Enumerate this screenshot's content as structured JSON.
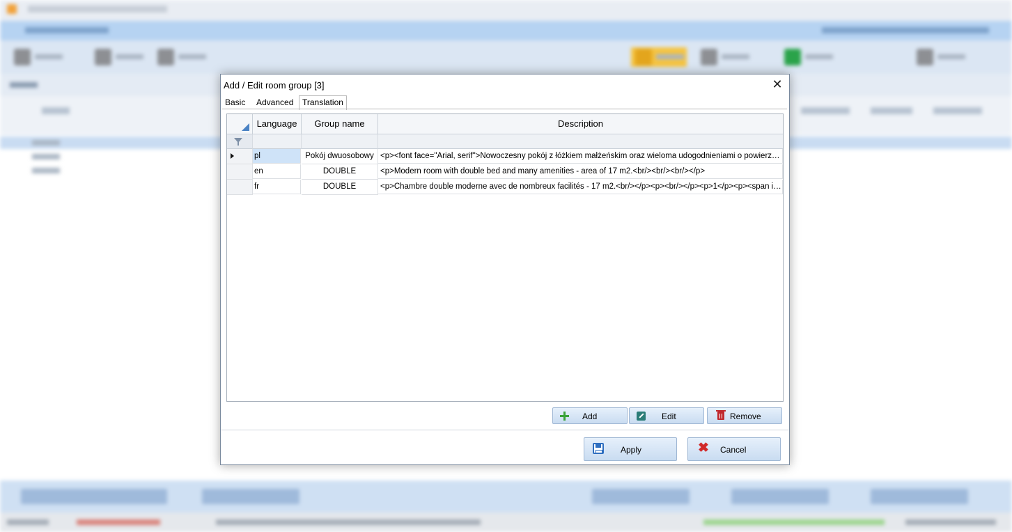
{
  "dialog": {
    "title": "Add / Edit room group [3]",
    "close_glyph": "✕",
    "tabs": [
      {
        "label": "Basic",
        "active": false
      },
      {
        "label": "Advanced",
        "active": false
      },
      {
        "label": "Translation",
        "active": true
      }
    ],
    "grid": {
      "columns": {
        "language": "Language",
        "group_name": "Group name",
        "description": "Description"
      },
      "rows": [
        {
          "language": "pl",
          "group_name": "Pokój dwuosobowy",
          "description": "<p><font face=\"Arial, serif\">Nowoczesny pokój z łóżkiem małżeńskim oraz wieloma udogodnieniami o powierzchni ...",
          "selected": true
        },
        {
          "language": "en",
          "group_name": "DOUBLE",
          "description": "<p>Modern room with double bed and many amenities - area of 17 m2.<br/><br/><br/></p>",
          "selected": false
        },
        {
          "language": "fr",
          "group_name": "DOUBLE",
          "description": "<p>Chambre double moderne avec de nombreux facilités - 17 m2.<br/></p><p><br/></p><p>1</p><p><span id=\"...",
          "selected": false
        }
      ]
    },
    "buttons": {
      "add": "Add",
      "edit": "Edit",
      "remove": "Remove",
      "apply": "Apply",
      "cancel": "Cancel"
    },
    "colors": {
      "accent": "#4a82c4",
      "selected_cell": "#cfe3f8",
      "add_icon": "#3aa33a",
      "edit_icon": "#2b7d78",
      "remove_icon": "#c0282d",
      "cancel_icon": "#d12a2a"
    }
  }
}
